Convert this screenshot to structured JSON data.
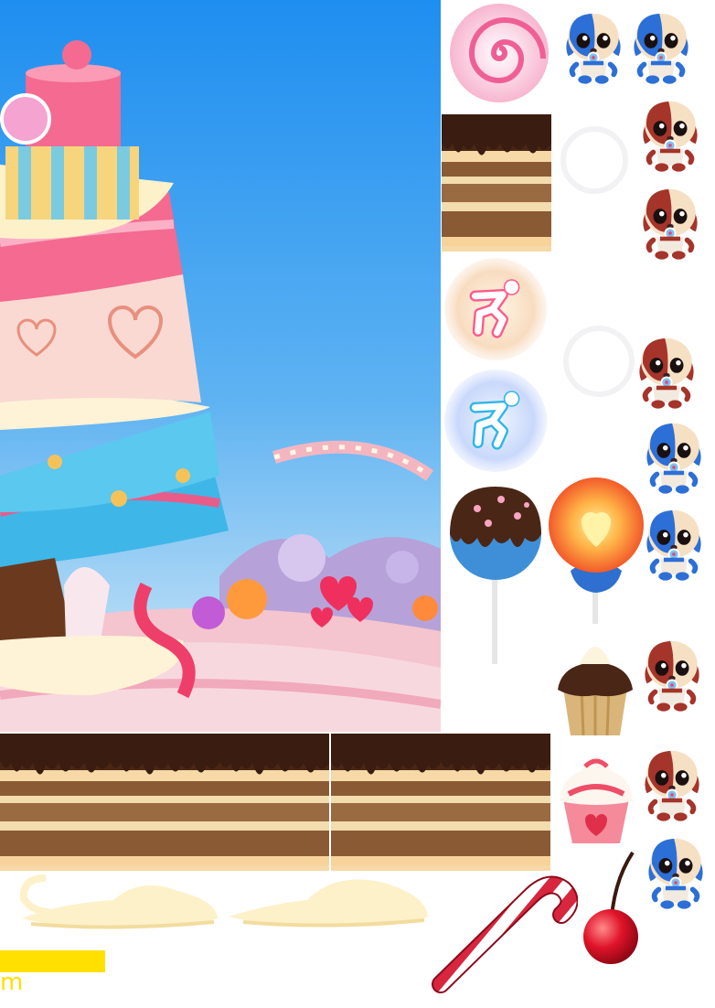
{
  "sheet": {
    "background": "#ffffff",
    "caption_text": "m",
    "caption_color": "#ffe000",
    "bar_color": "#ffe000"
  },
  "palette": {
    "sky_top": "#1e8ef0",
    "sky_bottom": "#cfe6f7",
    "chocolate": "#4a2616",
    "cake_layer": "#8a5a34",
    "cream": "#fdf1c9",
    "pink": "#f46a91",
    "candy_red": "#d7263d",
    "puppy_blue": "#2c6fd6",
    "puppy_brown": "#a5342a"
  },
  "sprites": [
    {
      "name": "background-scene",
      "icon": "candy-land-cake-scene"
    },
    {
      "name": "lollipop-swirl",
      "icon": "swirl-lollipop-icon"
    },
    {
      "name": "cake-tile-small",
      "icon": "chocolate-cake-tile"
    },
    {
      "name": "jump-button-warm",
      "icon": "jump-figure-icon"
    },
    {
      "name": "jump-button-blue",
      "icon": "jump-figure-icon"
    },
    {
      "name": "cake-pop",
      "icon": "cake-pop-icon"
    },
    {
      "name": "heart-lollipop",
      "icon": "heart-lollipop-icon"
    },
    {
      "name": "chocolate-cupcake",
      "icon": "cupcake-icon"
    },
    {
      "name": "strawberry-cupcake",
      "icon": "cupcake-icon"
    },
    {
      "name": "cream-cloud",
      "icon": "cream-cloud-icon"
    },
    {
      "name": "candy-cane",
      "icon": "candy-cane-icon"
    },
    {
      "name": "cherry",
      "icon": "cherry-icon"
    },
    {
      "name": "puppy-blue",
      "icon": "puppy-character-icon"
    },
    {
      "name": "puppy-brown",
      "icon": "puppy-character-icon"
    }
  ]
}
